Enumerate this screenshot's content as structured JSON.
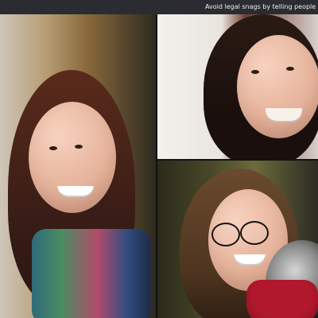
{
  "banner": {
    "text": "Avoid legal snags by telling people they're"
  },
  "video_grid": {
    "tiles": [
      {
        "label": "participant-left"
      },
      {
        "label": "participant-top-right"
      },
      {
        "label": "participant-bottom-right"
      }
    ]
  },
  "colors": {
    "banner_bg": "#2a2c31",
    "banner_text": "#f0f0f0"
  }
}
